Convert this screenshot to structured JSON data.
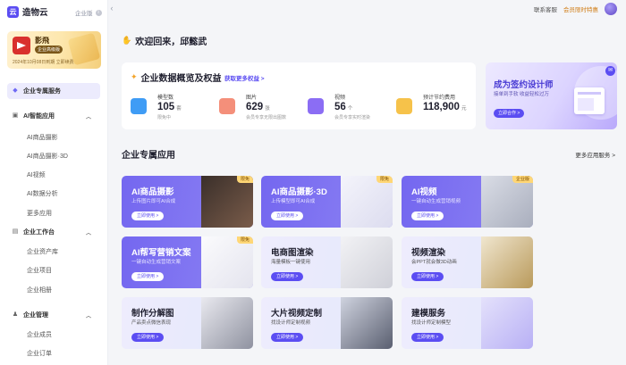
{
  "brand": {
    "name": "造物云",
    "logo_glyph": "云",
    "edition": "企业版"
  },
  "user": {
    "name": "影飛",
    "tag": "企业高级版",
    "expire_text": "2024年10月08日到期 立即续费"
  },
  "sidebar": {
    "items": [
      {
        "label": "企业专属服务",
        "kind": "active",
        "icon": "diamond-icon",
        "glyph": "◆"
      },
      {
        "label": "AI智能应用",
        "kind": "group",
        "icon": "ai-icon",
        "glyph": "▣"
      },
      {
        "label": "AI商品摄影",
        "kind": "sub"
      },
      {
        "label": "AI商品摄影·3D",
        "kind": "sub"
      },
      {
        "label": "AI视频",
        "kind": "sub"
      },
      {
        "label": "AI数据分析",
        "kind": "sub"
      },
      {
        "label": "更多应用",
        "kind": "sub"
      },
      {
        "label": "企业工作台",
        "kind": "group",
        "icon": "workbench-icon",
        "glyph": "▤"
      },
      {
        "label": "企业资产库",
        "kind": "sub"
      },
      {
        "label": "企业项目",
        "kind": "sub"
      },
      {
        "label": "企业相册",
        "kind": "sub"
      },
      {
        "label": "企业管理",
        "kind": "group",
        "icon": "manage-icon",
        "glyph": "♟"
      },
      {
        "label": "企业成员",
        "kind": "sub"
      },
      {
        "label": "企业订单",
        "kind": "sub"
      }
    ]
  },
  "header": {
    "support": "联系客服",
    "vip": "会员限时特惠"
  },
  "welcome": "欢迎回来，邱懿武",
  "overview": {
    "title": "企业数据概览及权益",
    "link": "获取更多权益 >",
    "stats": [
      {
        "label": "模型数",
        "value": "105",
        "unit": "套",
        "note": "限免中",
        "color": "#3f9cf5"
      },
      {
        "label": "图片",
        "value": "629",
        "unit": "张",
        "note": "会员专享无限出图数",
        "color": "#f48f7a"
      },
      {
        "label": "视频",
        "value": "56",
        "unit": "个",
        "note": "会员专享实时渲染",
        "color": "#8b6df4"
      },
      {
        "label": "预计节约费用",
        "value": "118,900",
        "unit": "元",
        "note": "",
        "color": "#f6c24a"
      }
    ]
  },
  "promo": {
    "title": "成为签约设计师",
    "subtitle": "接单到手软 收益轻松过万",
    "button": "立即合作 >"
  },
  "apps": {
    "title": "企业专属应用",
    "more": "更多应用服务 >",
    "cards": [
      {
        "title": "AI商品摄影",
        "desc": "上传图片即可AI合成",
        "button": "立即使用 >",
        "style": "dark",
        "badge": "限免"
      },
      {
        "title": "AI商品摄影·3D",
        "desc": "上传模型即可AI合成",
        "button": "立即使用 >",
        "style": "dark",
        "badge": "限免"
      },
      {
        "title": "AI视频",
        "desc": "一键自动生成营销视频",
        "button": "立即使用 >",
        "style": "dark",
        "badge": "企业版"
      },
      {
        "title": "AI帮写营销文案",
        "desc": "一键自动生成营销文案",
        "button": "立即使用 >",
        "style": "dark",
        "badge": "限免"
      },
      {
        "title": "电商图渲染",
        "desc": "海量模板一键使用",
        "button": "立即使用 >",
        "style": "light",
        "badge": ""
      },
      {
        "title": "视频渲染",
        "desc": "会PPT就会做3D动画",
        "button": "立即使用 >",
        "style": "light",
        "badge": ""
      },
      {
        "title": "制作分解图",
        "desc": "产品卖点微信表现",
        "button": "立即使用 >",
        "style": "light",
        "badge": ""
      },
      {
        "title": "大片视频定制",
        "desc": "找设计师定制视频",
        "button": "立即使用 >",
        "style": "light",
        "badge": ""
      },
      {
        "title": "建模服务",
        "desc": "找设计师定制模型",
        "button": "立即使用 >",
        "style": "light",
        "badge": ""
      }
    ]
  },
  "colors": {
    "accent": "#5b4df2",
    "card_dark": "#7467f0",
    "card_light": "#eeecfd",
    "vip": "#d07d16"
  }
}
